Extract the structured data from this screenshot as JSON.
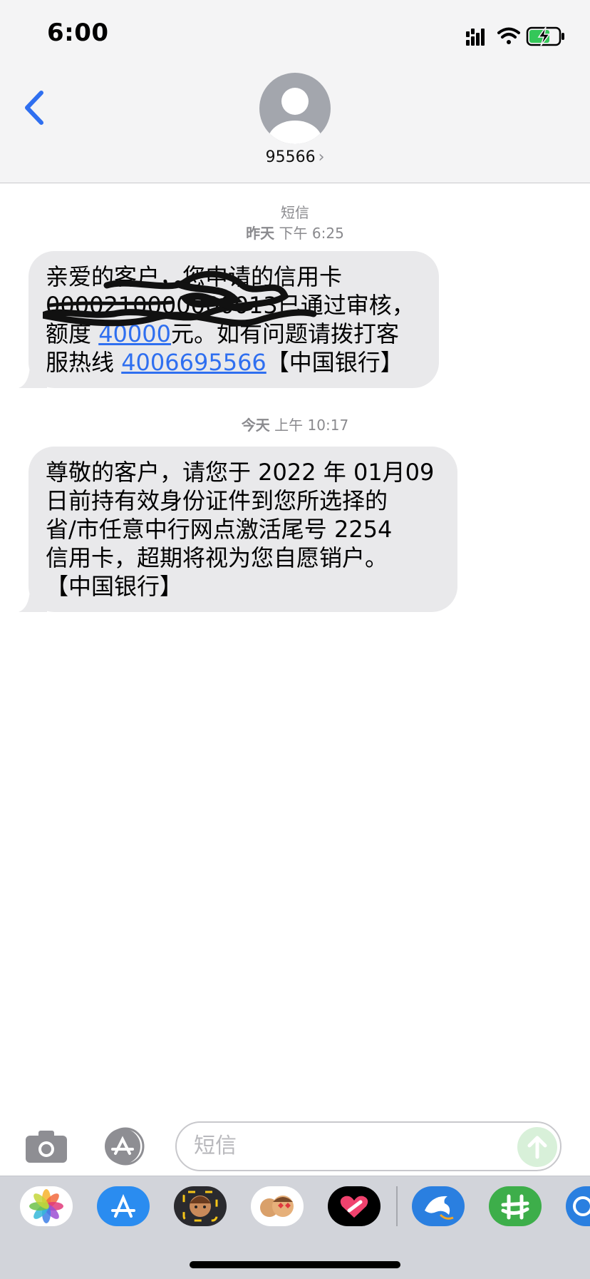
{
  "status_bar": {
    "time": "6:00",
    "icons": [
      "cellular-signal-icon",
      "wifi-icon",
      "battery-charging-icon"
    ],
    "battery_color": "#34c759"
  },
  "header": {
    "back_icon": "chevron-left-icon",
    "avatar_icon": "person-icon",
    "contact": "95566",
    "contact_chevron": "›",
    "accent": "#2f6ff0"
  },
  "timestamps": [
    {
      "label": "短信",
      "time_bold": "昨天",
      "time": "下午 6:25"
    },
    {
      "time_bold": "今天",
      "time": "上午 10:17"
    }
  ],
  "messages": [
    {
      "lines": [
        {
          "parts": [
            {
              "text": "亲爱的客户，您申请的信用卡"
            }
          ]
        },
        {
          "parts": [
            {
              "text": "0000210000000013已通过审核，"
            }
          ]
        },
        {
          "parts": [
            {
              "text": "额度 "
            },
            {
              "text": "40000",
              "link": true
            },
            {
              "text": "元。如有问题请拨打客"
            }
          ]
        },
        {
          "parts": [
            {
              "text": "服热线 "
            },
            {
              "text": "4006695566",
              "link": true
            },
            {
              "text": "【中国银行】"
            }
          ]
        }
      ]
    },
    {
      "lines": [
        {
          "parts": [
            {
              "text": "尊敬的客户，请您于 2022 年 01月09"
            }
          ]
        },
        {
          "parts": [
            {
              "text": "日前持有效身份证件到您所选择的"
            }
          ]
        },
        {
          "parts": [
            {
              "text": "省/市任意中行网点激活尾号 2254"
            }
          ]
        },
        {
          "parts": [
            {
              "text": "信用卡，超期将视为您自愿销户。"
            }
          ]
        },
        {
          "parts": [
            {
              "text": "【中国银行】"
            }
          ]
        }
      ]
    }
  ],
  "composer": {
    "camera_icon": "camera-icon",
    "apps_icon": "app-store-icon",
    "placeholder": "短信",
    "send_icon": "arrow-up-icon"
  },
  "app_drawer": {
    "apps": [
      "photos-icon",
      "app-store-icon",
      "memoji-icon",
      "animoji-icon",
      "digital-touch-icon",
      "dolphin-app-icon",
      "green-app-icon",
      "blue-app-icon"
    ]
  }
}
